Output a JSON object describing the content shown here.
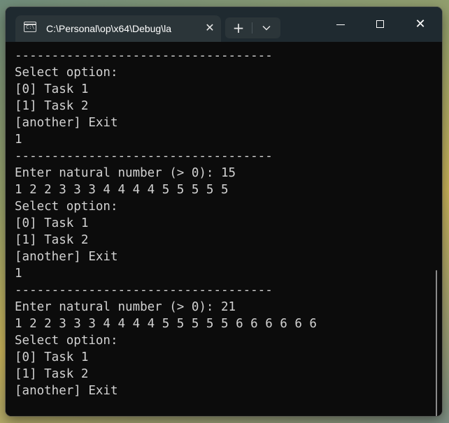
{
  "tab": {
    "icon": "console-icon",
    "icon_glyph": "C:\\",
    "title": "C:\\Personal\\op\\x64\\Debug\\la",
    "close": "✕"
  },
  "toolbar": {
    "new_tab": "+",
    "dropdown": "⌄"
  },
  "window_controls": {
    "minimize": "—",
    "maximize": "☐",
    "close": "✕"
  },
  "console": {
    "lines": [
      "-----------------------------------",
      "Select option:",
      "[0] Task 1",
      "[1] Task 2",
      "[another] Exit",
      "1",
      "-----------------------------------",
      "Enter natural number (> 0): 15",
      "1 2 2 3 3 3 4 4 4 4 5 5 5 5 5",
      "Select option:",
      "[0] Task 1",
      "[1] Task 2",
      "[another] Exit",
      "1",
      "-----------------------------------",
      "Enter natural number (> 0): 21",
      "1 2 2 3 3 3 4 4 4 4 5 5 5 5 5 6 6 6 6 6 6",
      "Select option:",
      "[0] Task 1",
      "[1] Task 2",
      "[another] Exit"
    ]
  },
  "colors": {
    "console_bg": "#0c0c0c",
    "console_text": "#d2d2d2",
    "titlebar_bg": "#1f2a30",
    "tab_bg": "#2b3539"
  }
}
